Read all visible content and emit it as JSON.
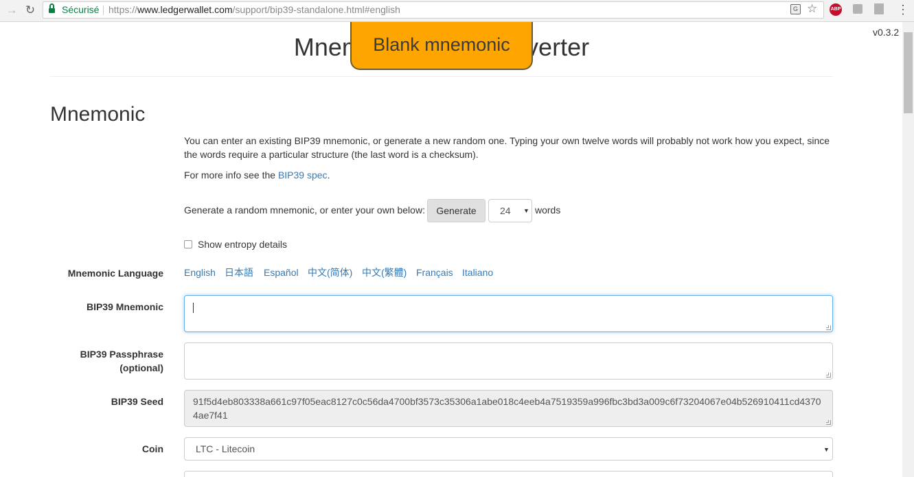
{
  "browser": {
    "secure_label": "Sécurisé",
    "url_prefix": "https://",
    "url_host": "www.ledgerwallet.com",
    "url_path": "/support/bip39-standalone.html#english",
    "abp_label": "ABP"
  },
  "page": {
    "version": "v0.3.2",
    "title": "Mnemonic Code Converter",
    "banner": "Blank mnemonic"
  },
  "mnemonic": {
    "section_title": "Mnemonic",
    "intro": "You can enter an existing BIP39 mnemonic, or generate a new random one. Typing your own twelve words will probably not work how you expect, since the words require a particular structure (the last word is a checksum).",
    "more_info_prefix": "For more info see the ",
    "more_info_link": "BIP39 spec",
    "more_info_suffix": ".",
    "generate_prompt": "Generate a random mnemonic, or enter your own below:",
    "generate_button": "Generate",
    "word_count": "24",
    "words_suffix": "words",
    "entropy_label": "Show entropy details",
    "language_label": "Mnemonic Language",
    "languages": [
      "English",
      "日本語",
      "Español",
      "中文(简体)",
      "中文(繁體)",
      "Français",
      "Italiano"
    ],
    "bip39_mnemonic_label": "BIP39 Mnemonic",
    "bip39_mnemonic_value": "",
    "passphrase_label_1": "BIP39 Passphrase",
    "passphrase_label_2": "(optional)",
    "passphrase_value": "",
    "seed_label": "BIP39 Seed",
    "seed_value": "91f5d4eb803338a661c97f05eac8127c0c56da4700bf3573c35306a1abe018c4eeb4a7519359a996fbc3bd3a009c6f73204067e04b526910411cd43704ae7f41",
    "coin_label": "Coin",
    "coin_value": "LTC - Litecoin"
  }
}
